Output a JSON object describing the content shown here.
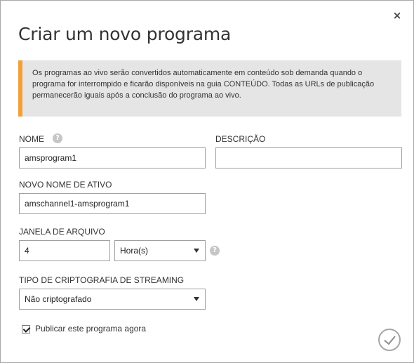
{
  "dialog": {
    "title": "Criar um novo programa",
    "close_label": "×",
    "notice": "Os programas ao vivo serão convertidos automaticamente em conteúdo sob demanda quando o programa for interrompido e ficarão disponíveis na guia CONTEÚDO. Todas as URLs de publicação permanecerão iguais após a conclusão do programa ao vivo.",
    "accent_color": "#f0a03c"
  },
  "form": {
    "name_label": "NOME",
    "name_value": "amsprogram1",
    "description_label": "DESCRIÇÃO",
    "description_value": "",
    "asset_label": "NOVO NOME DE ATIVO",
    "asset_value": "amschannel1-amsprogram1",
    "archive_label": "JANELA DE ARQUIVO",
    "archive_value": "4",
    "archive_unit": "Hora(s)",
    "encryption_label": "TIPO DE CRIPTOGRAFIA DE STREAMING",
    "encryption_value": "Não criptografado",
    "publish_label": "Publicar este programa agora",
    "publish_checked": true,
    "help_glyph": "?"
  }
}
